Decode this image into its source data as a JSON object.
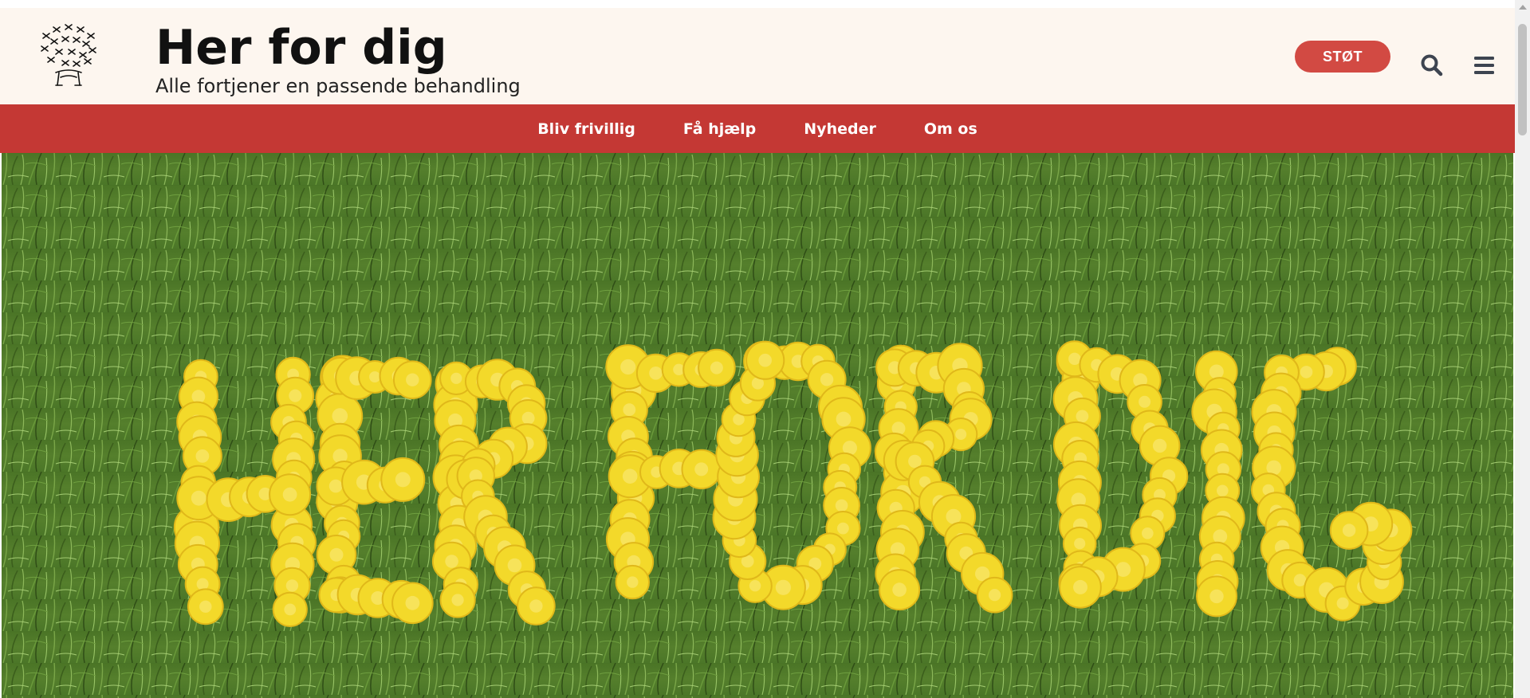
{
  "header": {
    "title": "Her for dig",
    "tagline": "Alle fortjener en passende behandling",
    "donate_label": "STØT",
    "logo_icon": "dandelion-logo-icon",
    "search_icon": "search-icon",
    "menu_icon": "hamburger-menu-icon"
  },
  "nav": {
    "items": [
      {
        "label": "Bliv frivillig"
      },
      {
        "label": "Få hjælp"
      },
      {
        "label": "Nyheder"
      },
      {
        "label": "Om os"
      }
    ]
  },
  "hero": {
    "image_text": "HER FOR DIG"
  },
  "colors": {
    "header_bg": "#fdf6ef",
    "nav_bg": "#c43834",
    "button_bg": "#d24a43",
    "grass": "#4f7a2a",
    "flower": "#f3d92a"
  }
}
